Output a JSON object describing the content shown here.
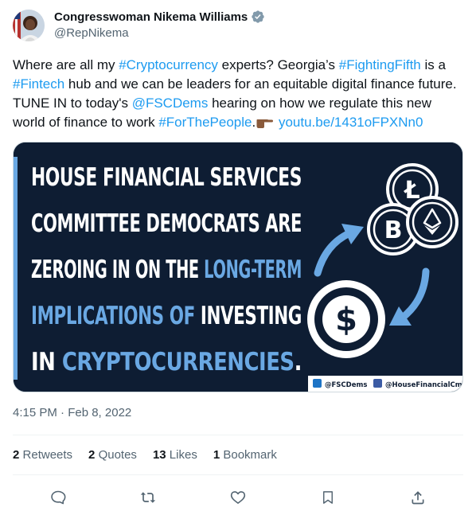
{
  "author": {
    "name": "Congresswoman Nikema Williams",
    "handle": "@RepNikema",
    "avatar_icon": "avatar-photo"
  },
  "tweet": {
    "p1": "Where are all my ",
    "l1": "#Cryptocurrency",
    "p2": " experts? Georgia’s ",
    "l2": "#FightingFifth",
    "p3": " is a ",
    "l3": "#Fintech",
    "p4": " hub and we can be leaders for an equitable digital finance future. TUNE IN to today's ",
    "l4": "@FSCDems",
    "p5": " hearing on how we regulate this new world of finance to work ",
    "l5": "#ForThePeople",
    "p6": ".",
    "l6": "youtu.be/1431oFPXNn0",
    "emoji": "pointing-hand-icon"
  },
  "media": {
    "lines": [
      {
        "segments": [
          {
            "text": "HOUSE FINANCIAL SERVICES",
            "accent": false
          }
        ]
      },
      {
        "segments": [
          {
            "text": "COMMITTEE DEMOCRATS ARE",
            "accent": false
          }
        ]
      },
      {
        "segments": [
          {
            "text": "ZEROING IN ON THE ",
            "accent": false
          },
          {
            "text": "LONG-TERM",
            "accent": true
          }
        ]
      },
      {
        "segments": [
          {
            "text": "IMPLICATIONS OF ",
            "accent": true
          },
          {
            "text": "INVESTING",
            "accent": false
          }
        ]
      },
      {
        "segments": [
          {
            "text": "IN ",
            "accent": false
          },
          {
            "text": "CRYPTOCURRENCIES",
            "accent": true
          },
          {
            "text": ".",
            "accent": false
          }
        ]
      }
    ],
    "footer_twitter": "@FSCDems",
    "footer_facebook": "@HouseFinancialCmte",
    "colors": {
      "background": "#0e1d33",
      "accent": "#6aa8e3",
      "text": "#ffffff"
    }
  },
  "timestamp": "4:15 PM · Feb 8, 2022",
  "stats": {
    "retweets_count": "2",
    "retweets_label": "Retweets",
    "quotes_count": "2",
    "quotes_label": "Quotes",
    "likes_count": "13",
    "likes_label": "Likes",
    "bookmarks_count": "1",
    "bookmarks_label": "Bookmark"
  },
  "colors": {
    "link": "#1d9bf0",
    "secondary_text": "#536471"
  }
}
